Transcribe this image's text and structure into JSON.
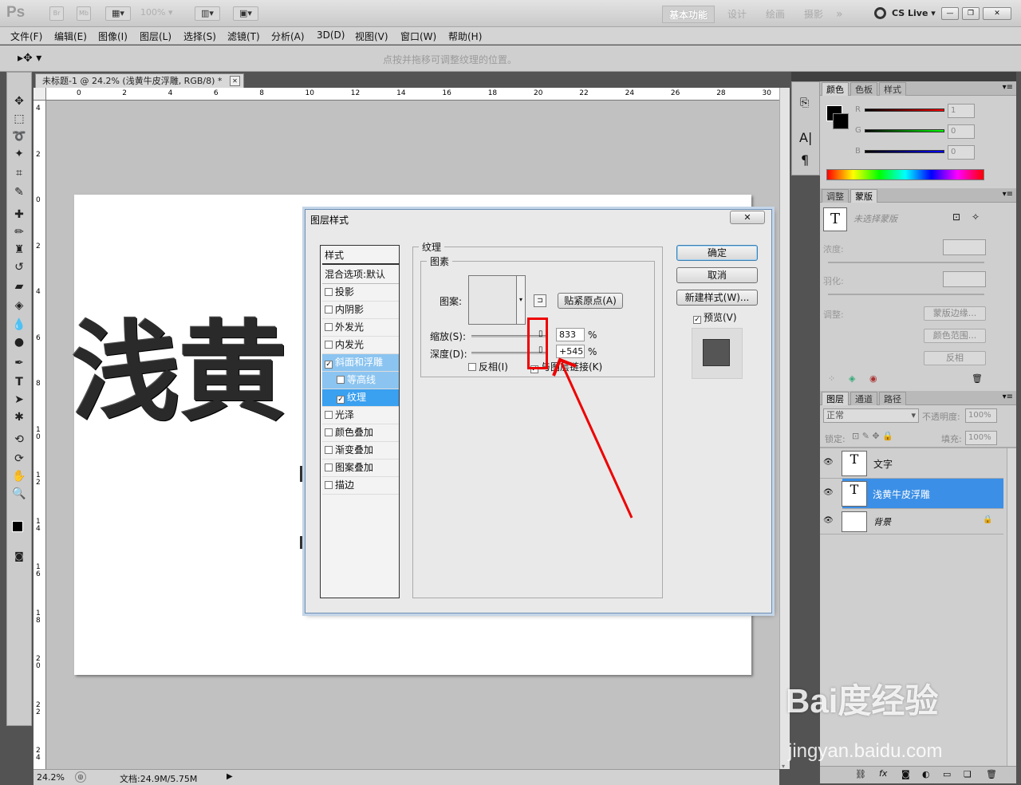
{
  "app": {
    "logo": "Ps",
    "bridge": "Br",
    "minibridge": "Mb",
    "zoom": "100%"
  },
  "workspaces": {
    "basic": "基本功能",
    "design": "设计",
    "paint": "绘画",
    "photo": "摄影",
    "more": "»",
    "cslive": "CS Live"
  },
  "window_controls": {
    "min": "—",
    "restore": "❐",
    "close": "✕"
  },
  "menu": [
    "文件(F)",
    "编辑(E)",
    "图像(I)",
    "图层(L)",
    "选择(S)",
    "滤镜(T)",
    "分析(A)",
    "3D(D)",
    "视图(V)",
    "窗口(W)",
    "帮助(H)"
  ],
  "options": {
    "hint": "点按并拖移可调整纹理的位置。"
  },
  "document": {
    "tab_title": "未标题-1 @ 24.2% (浅黄牛皮浮雕, RGB/8) *",
    "tab_close": "✕",
    "canvas_text": "浅黄",
    "ruler_h": [
      "0",
      "2",
      "4",
      "6",
      "8",
      "10",
      "12",
      "14",
      "16",
      "18",
      "20",
      "22",
      "24",
      "26",
      "28",
      "30"
    ],
    "ruler_v": [
      "4",
      "2",
      "0",
      "2",
      "4",
      "6",
      "8",
      "1\n0",
      "1\n2",
      "1\n4",
      "1\n6",
      "1\n8",
      "2\n0",
      "2\n2",
      "2\n4"
    ],
    "zoom": "24.2%",
    "status": "文档:24.9M/5.75M"
  },
  "dialog": {
    "title": "图层样式",
    "close": "✕",
    "styles_header": "样式",
    "blend_options": "混合选项:默认",
    "items": [
      {
        "label": "投影",
        "checked": false
      },
      {
        "label": "内阴影",
        "checked": false
      },
      {
        "label": "外发光",
        "checked": false
      },
      {
        "label": "内发光",
        "checked": false
      },
      {
        "label": "斜面和浮雕",
        "checked": true
      },
      {
        "label": "等高线",
        "checked": false
      },
      {
        "label": "纹理",
        "checked": true
      },
      {
        "label": "光泽",
        "checked": false
      },
      {
        "label": "颜色叠加",
        "checked": false
      },
      {
        "label": "渐变叠加",
        "checked": false
      },
      {
        "label": "图案叠加",
        "checked": false
      },
      {
        "label": "描边",
        "checked": false
      }
    ],
    "group_title": "纹理",
    "subgroup_title": "图素",
    "pattern_label": "图案:",
    "snap_origin": "贴紧原点(A)",
    "scale_label": "缩放(S):",
    "scale_value": "833",
    "scale_unit": "%",
    "depth_label": "深度(D):",
    "depth_value": "+545",
    "depth_unit": "%",
    "invert_label": "反相(I)",
    "link_label": "与图层链接(K)",
    "ok": "确定",
    "cancel": "取消",
    "new_style": "新建样式(W)...",
    "preview_label": "预览(V)"
  },
  "color_panel": {
    "tabs": [
      "颜色",
      "色板",
      "样式"
    ],
    "r_label": "R",
    "g_label": "G",
    "b_label": "B",
    "r": "1",
    "g": "0",
    "b": "0"
  },
  "adjust_panel": {
    "tabs": [
      "调整",
      "蒙版"
    ],
    "mask_status": "未选择蒙版",
    "density_label": "浓度:",
    "feather_label": "羽化:",
    "refine_label": "调整:",
    "mask_edge": "蒙版边缘...",
    "color_range": "颜色范围...",
    "invert": "反相"
  },
  "layers_panel": {
    "tabs": [
      "图层",
      "通道",
      "路径"
    ],
    "blend_mode": "正常",
    "opacity_label": "不透明度:",
    "opacity": "100%",
    "lock_label": "锁定:",
    "fill_label": "填充:",
    "fill": "100%",
    "layers": [
      {
        "name": "文字",
        "type": "text",
        "selected": false
      },
      {
        "name": "浅黄牛皮浮雕",
        "type": "text",
        "selected": true
      },
      {
        "name": "背景",
        "type": "background",
        "selected": false
      }
    ],
    "thumb_text": "T"
  },
  "watermark": {
    "brand": "Bai度经验",
    "url": "jingyan.baidu.com"
  },
  "colors": {
    "accent": "#3aa0f0",
    "annotation": "#e00000",
    "layer_selected": "#3b8fe6"
  }
}
